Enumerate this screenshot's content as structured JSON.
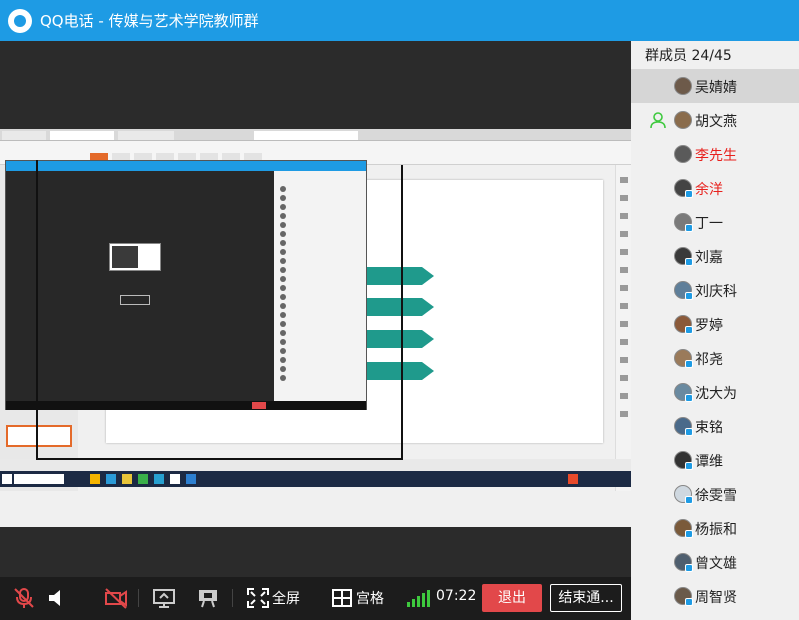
{
  "window": {
    "app_name": "QQ电话",
    "separator": " - ",
    "group_name": "传媒与艺术学院教师群"
  },
  "members": {
    "header": "群成员 24/45",
    "list": [
      {
        "name": "吴婧婧",
        "color": "#222222",
        "selected": true,
        "mobile": false
      },
      {
        "name": "胡文燕",
        "color": "#222222",
        "selected": false,
        "mobile": false,
        "speaking": true
      },
      {
        "name": "李先生",
        "color": "#e8211d",
        "selected": false,
        "mobile": false
      },
      {
        "name": "余洋",
        "color": "#e8211d",
        "selected": false,
        "mobile": true
      },
      {
        "name": "丁一",
        "color": "#222222",
        "selected": false,
        "mobile": true
      },
      {
        "name": "刘嘉",
        "color": "#222222",
        "selected": false,
        "mobile": true
      },
      {
        "name": "刘庆科",
        "color": "#222222",
        "selected": false,
        "mobile": true
      },
      {
        "name": "罗婷",
        "color": "#222222",
        "selected": false,
        "mobile": true
      },
      {
        "name": "祁尧",
        "color": "#222222",
        "selected": false,
        "mobile": true
      },
      {
        "name": "沈大为",
        "color": "#222222",
        "selected": false,
        "mobile": true
      },
      {
        "name": "束铭",
        "color": "#222222",
        "selected": false,
        "mobile": true
      },
      {
        "name": "谭维",
        "color": "#222222",
        "selected": false,
        "mobile": true
      },
      {
        "name": "徐雯雪",
        "color": "#222222",
        "selected": false,
        "mobile": true
      },
      {
        "name": "杨振和",
        "color": "#222222",
        "selected": false,
        "mobile": true
      },
      {
        "name": "曾文雄",
        "color": "#222222",
        "selected": false,
        "mobile": true
      },
      {
        "name": "周智贤",
        "color": "#222222",
        "selected": false,
        "mobile": true
      }
    ]
  },
  "toolbar": {
    "fullscreen_label": "全屏",
    "grid_label": "宫格",
    "timer": "07:22",
    "exit_label": "退出",
    "end_label": "结束通..."
  },
  "colors": {
    "titlebar": "#1e9be4",
    "exit_button": "#e2484a",
    "mic_muted": "#e2484a",
    "signal": "#3ec93e",
    "slide_arrow": "#1f9a8c"
  },
  "icons": {
    "mic": "mic-muted-icon",
    "speaker": "speaker-icon",
    "camera": "camera-off-icon",
    "screen_share": "screen-share-icon",
    "presentation": "presentation-icon",
    "fullscreen": "fullscreen-icon",
    "grid": "grid-icon",
    "signal": "signal-icon"
  }
}
